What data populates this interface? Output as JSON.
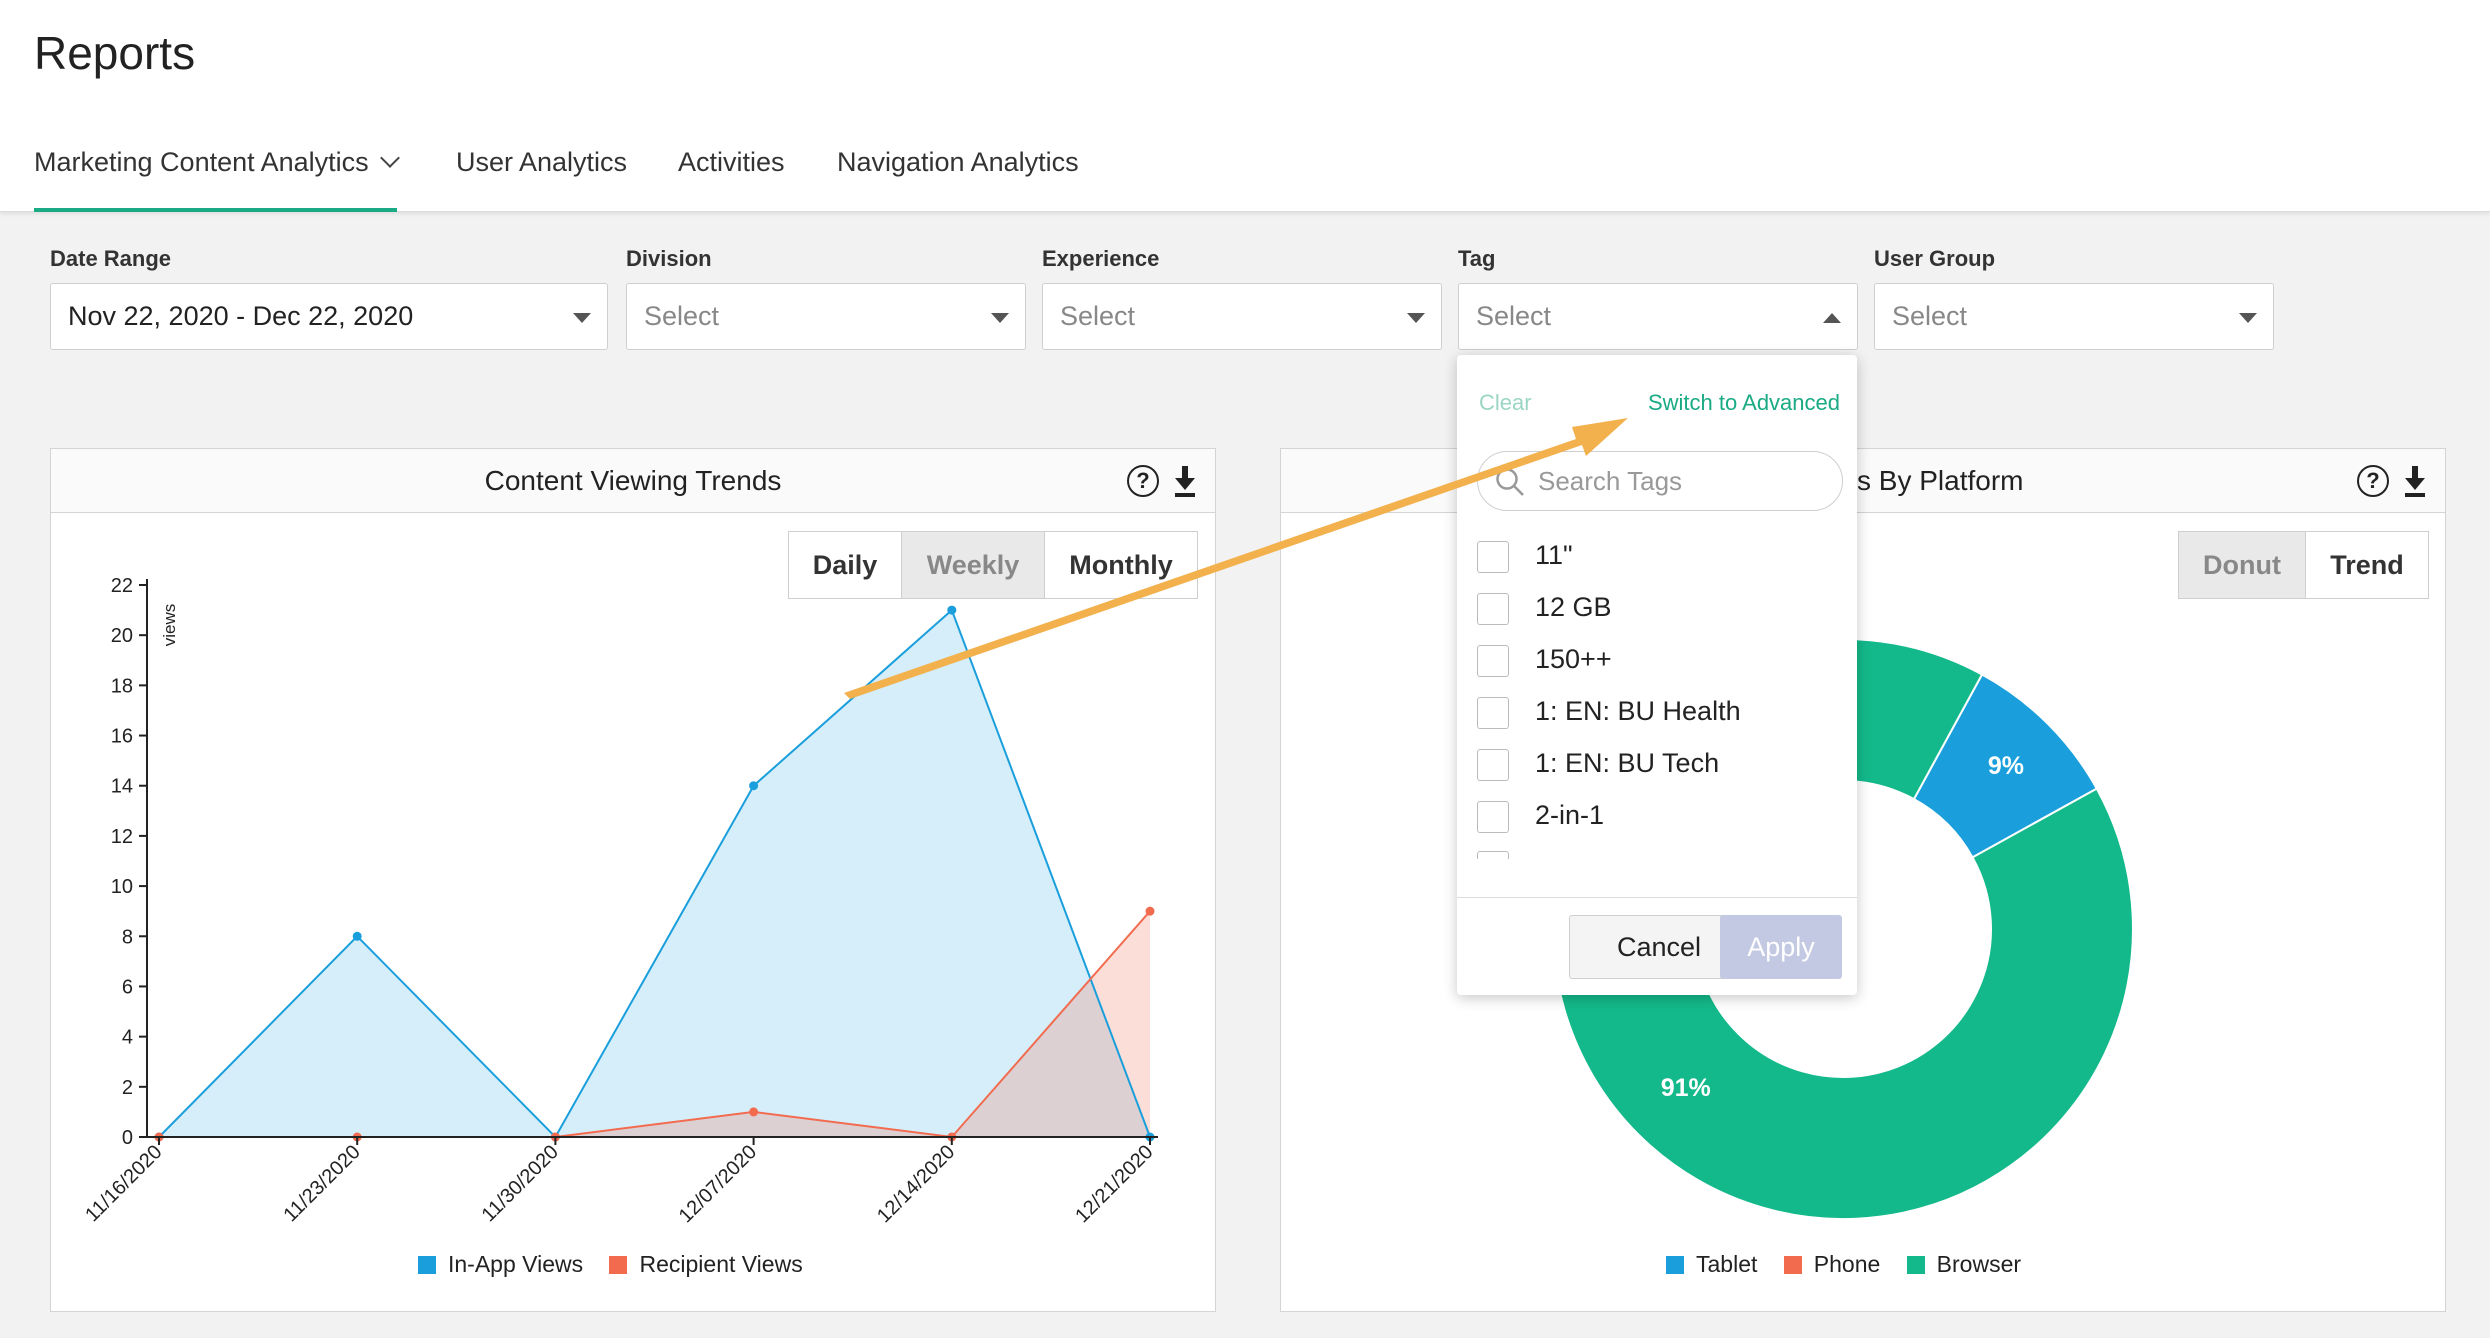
{
  "page": {
    "title": "Reports"
  },
  "tabs": [
    {
      "label": "Marketing Content Analytics"
    },
    {
      "label": "User Analytics"
    },
    {
      "label": "Activities"
    },
    {
      "label": "Navigation Analytics"
    }
  ],
  "filters": [
    {
      "label": "Date Range",
      "value": "Nov 22, 2020 - Dec 22, 2020"
    },
    {
      "label": "Division",
      "value": "Select"
    },
    {
      "label": "Experience",
      "value": "Select"
    },
    {
      "label": "Tag",
      "value": "Select"
    },
    {
      "label": "User Group",
      "value": "Select"
    }
  ],
  "trends_panel": {
    "title": "Content Viewing Trends",
    "help_icon": "?",
    "buttons": [
      "Daily",
      "Weekly",
      "Monthly"
    ],
    "selected": "Weekly",
    "legend": [
      {
        "label": "In-App Views",
        "color": "#1a9fdc"
      },
      {
        "label": "Recipient Views",
        "color": "#f26b4f"
      }
    ]
  },
  "platform_panel": {
    "title_visible": "s By Platform",
    "help_icon": "?",
    "buttons": [
      "Donut",
      "Trend"
    ],
    "selected": "Donut",
    "legend": [
      {
        "label": "Tablet",
        "color": "#1a9fdc"
      },
      {
        "label": "Phone",
        "color": "#f26b4f"
      },
      {
        "label": "Browser",
        "color": "#13b98a"
      }
    ]
  },
  "tag_dropdown": {
    "clear_label": "Clear",
    "advanced_label": "Switch to Advanced",
    "search_placeholder": "Search Tags",
    "options": [
      "11\"",
      "12 GB",
      "150++",
      "1: EN: BU Health",
      "1: EN: BU Tech",
      "2-in-1"
    ],
    "cancel_label": "Cancel",
    "apply_label": "Apply"
  },
  "chart_data": [
    {
      "type": "area",
      "ylabel": "views",
      "ylim": [
        0,
        22
      ],
      "yticks": [
        "0",
        "2",
        "4",
        "6",
        "8",
        "10",
        "12",
        "14",
        "16",
        "18",
        "20",
        "22"
      ],
      "categories": [
        "11/16/2020",
        "11/23/2020",
        "11/30/2020",
        "12/07/2020",
        "12/14/2020",
        "12/21/2020"
      ],
      "series": [
        {
          "name": "In-App Views",
          "values": [
            0,
            8,
            0,
            14,
            21,
            0
          ],
          "color": "#1a9fdc"
        },
        {
          "name": "Recipient Views",
          "values": [
            0,
            0,
            0,
            1,
            0,
            9
          ],
          "color": "#f26b4f"
        }
      ],
      "grid": false,
      "legend_position": "bottom"
    },
    {
      "type": "pie",
      "categories": [
        "Tablet",
        "Phone",
        "Browser"
      ],
      "values": [
        9,
        0,
        91
      ],
      "labels": [
        "9%",
        "",
        "91%"
      ],
      "colors": [
        "#1a9fdc",
        "#f26b4f",
        "#13b98a"
      ],
      "legend_position": "bottom"
    }
  ]
}
